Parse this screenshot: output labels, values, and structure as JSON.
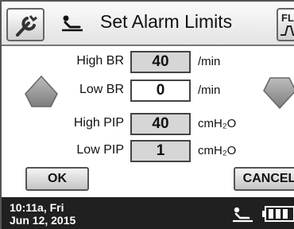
{
  "header": {
    "title": "Set Alarm Limits",
    "right_button_label": "FL"
  },
  "icons": {
    "tool": "wrench-icon",
    "patient": "patient-bed-icon",
    "increase": "arrow-up-icon",
    "decrease": "arrow-down-icon",
    "battery": "battery-icon"
  },
  "alarms": [
    {
      "label": "High BR",
      "value": "40",
      "unit": "/min",
      "selected": false
    },
    {
      "label": "Low BR",
      "value": "0",
      "unit": "/min",
      "selected": true
    },
    {
      "label": "High PIP",
      "value": "40",
      "unit": "cmH₂O",
      "selected": false
    },
    {
      "label": "Low PIP",
      "value": "1",
      "unit": "cmH₂O",
      "selected": false
    }
  ],
  "buttons": {
    "ok_label": "OK",
    "cancel_label": "CANCEL"
  },
  "status": {
    "time": "10:11a, Fri",
    "date": "Jun 12, 2015",
    "battery_level": 1.0
  },
  "colors": {
    "footer_bg": "#202020",
    "value_bg": "#d6d6d6",
    "selected_value_bg": "#ffffff"
  }
}
